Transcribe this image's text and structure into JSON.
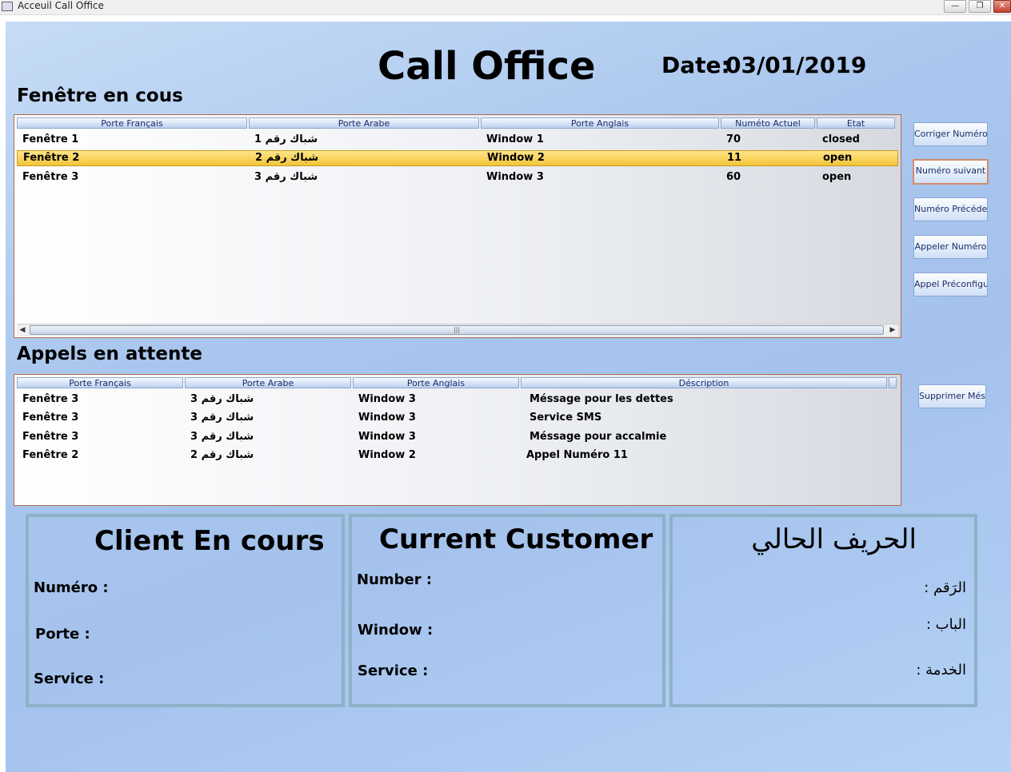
{
  "window": {
    "title": "Acceuil Call Office",
    "min_label": "—",
    "max_label": "❐",
    "close_label": "✕"
  },
  "header": {
    "title": "Call Office",
    "date_label": "Date:",
    "date_value": "03/01/2019"
  },
  "current_windows": {
    "title": "Fenêtre en cous",
    "columns": [
      "Porte Français",
      "Porte Arabe",
      "Porte Anglais",
      "Numéto Actuel",
      "Etat"
    ],
    "rows": [
      [
        "Fenêtre 1",
        "شباك رقم 1",
        "Window 1",
        "70",
        "closed"
      ],
      [
        "Fenêtre 2",
        "شباك رقم 2",
        "Window 2",
        "11",
        "open"
      ],
      [
        "Fenêtre 3",
        "شباك رقم 3",
        "Window 3",
        "60",
        "open"
      ]
    ],
    "selected_row": 2
  },
  "actions": {
    "corriger": "Corriger Numéro",
    "suivant": "Numéro suivant",
    "precedent": "Numéro Précédent",
    "appeler": "Appeler Numéro",
    "preconfig": "Appel Préconfiguré",
    "supprimer": "Supprimer Méssage"
  },
  "pending_calls": {
    "title": "Appels en attente",
    "columns": [
      "Porte Français",
      "Porte Arabe",
      "Porte Anglais",
      "Déscription"
    ],
    "rows": [
      [
        "Fenêtre 3",
        "شباك رقم 3",
        "Window 3",
        "Méssage pour les dettes"
      ],
      [
        "Fenêtre 3",
        "شباك رقم 3",
        "Window 3",
        "Service SMS"
      ],
      [
        "Fenêtre 3",
        "شباك رقم 3",
        "Window 3",
        "Méssage pour accalmie"
      ],
      [
        "Fenêtre 2",
        "شباك رقم 2",
        "Window 2",
        "Appel Numéro 11"
      ]
    ]
  },
  "panels": {
    "fr": {
      "title": "Client En cours",
      "numero": "Numéro :",
      "porte": "Porte :",
      "service": "Service :"
    },
    "en": {
      "title": "Current Customer",
      "number": "Number :",
      "window": "Window :",
      "service": "Service :"
    },
    "ar": {
      "title": "الحريف الحالي",
      "number": "الرَقم :",
      "door": "الباب :",
      "service": "الخدمة :"
    }
  }
}
